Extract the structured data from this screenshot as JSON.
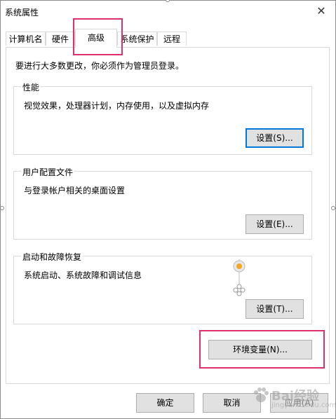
{
  "window": {
    "title": "系统属性",
    "close_glyph": "✕"
  },
  "tabs": [
    {
      "label": "计算机名"
    },
    {
      "label": "硬件"
    },
    {
      "label": "高级"
    },
    {
      "label": "系统保护"
    },
    {
      "label": "远程"
    }
  ],
  "admin_note": "要进行大多数更改，你必须作为管理员登录。",
  "performance": {
    "legend": "性能",
    "description": "视觉效果，处理器计划，内存使用，以及虚拟内存",
    "button": "设置(S)..."
  },
  "user_profiles": {
    "legend": "用户配置文件",
    "description": "与登录帐户相关的桌面设置",
    "button": "设置(E)..."
  },
  "startup_recovery": {
    "legend": "启动和故障恢复",
    "description": "系统启动、系统故障和调试信息",
    "button": "设置(T)..."
  },
  "env_button": "环境变量(N)...",
  "footer": {
    "ok": "确定",
    "cancel": "取消",
    "apply": "应用(A)"
  },
  "watermark": {
    "text": "Bai经验",
    "sub": "jingyan.baidu.com"
  },
  "colors": {
    "highlight": "#e0306a",
    "accent": "#0078d7"
  }
}
